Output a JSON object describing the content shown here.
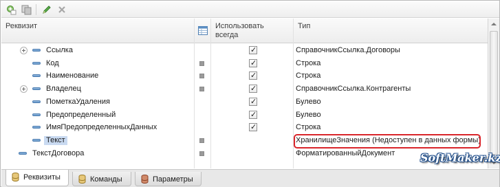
{
  "toolbar": {
    "buttons": [
      {
        "name": "add-icon"
      },
      {
        "name": "copy-icon"
      },
      {
        "name": "edit-icon"
      },
      {
        "name": "delete-icon"
      }
    ]
  },
  "columns": {
    "requisite": "Реквизит",
    "use_always": "Использовать всегда",
    "type": "Тип"
  },
  "rows": [
    {
      "label": "Ссылка",
      "type": "СправочникСсылка.Договоры",
      "expandable": true,
      "checked": true,
      "marker": false
    },
    {
      "label": "Код",
      "type": "Строка",
      "expandable": false,
      "checked": true,
      "marker": true
    },
    {
      "label": "Наименование",
      "type": "Строка",
      "expandable": false,
      "checked": true,
      "marker": true
    },
    {
      "label": "Владелец",
      "type": "СправочникСсылка.Контрагенты",
      "expandable": true,
      "checked": true,
      "marker": true
    },
    {
      "label": "ПометкаУдаления",
      "type": "Булево",
      "expandable": false,
      "checked": true,
      "marker": false
    },
    {
      "label": "Предопределенный",
      "type": "Булево",
      "expandable": false,
      "checked": true,
      "marker": false
    },
    {
      "label": "ИмяПредопределенныхДанных",
      "type": "Строка",
      "expandable": false,
      "checked": true,
      "marker": false
    },
    {
      "label": "Текст",
      "type": "ХранилищеЗначения (Недоступен в данных формы)",
      "expandable": false,
      "checked": false,
      "marker": true,
      "selected": true,
      "highlighted": true
    },
    {
      "label": "ТекстДоговора",
      "type": "ФорматированныйДокумент",
      "expandable": false,
      "checked": false,
      "marker": true,
      "top_level": true
    }
  ],
  "tabs": [
    {
      "label": "Реквизиты",
      "active": true
    },
    {
      "label": "Команды",
      "active": false
    },
    {
      "label": "Параметры",
      "active": false
    }
  ],
  "watermark": "SoftMaker.kz",
  "colors": {
    "highlight": "#d9242a",
    "selection": "#c9daf1",
    "dash_blue": "#5b8fc4"
  }
}
